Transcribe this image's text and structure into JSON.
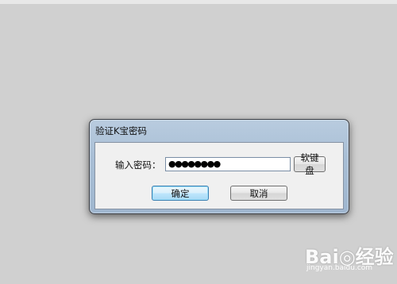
{
  "dialog": {
    "title": "验证K宝密码",
    "password_label": "输入密码：",
    "password_value": "●●●●●●●●",
    "soft_keyboard_label": "软键盘",
    "ok_label": "确定",
    "cancel_label": "取消"
  },
  "watermark": {
    "logo_text": "Bai◎经验",
    "url_text": "jingyan.baidu.com"
  }
}
